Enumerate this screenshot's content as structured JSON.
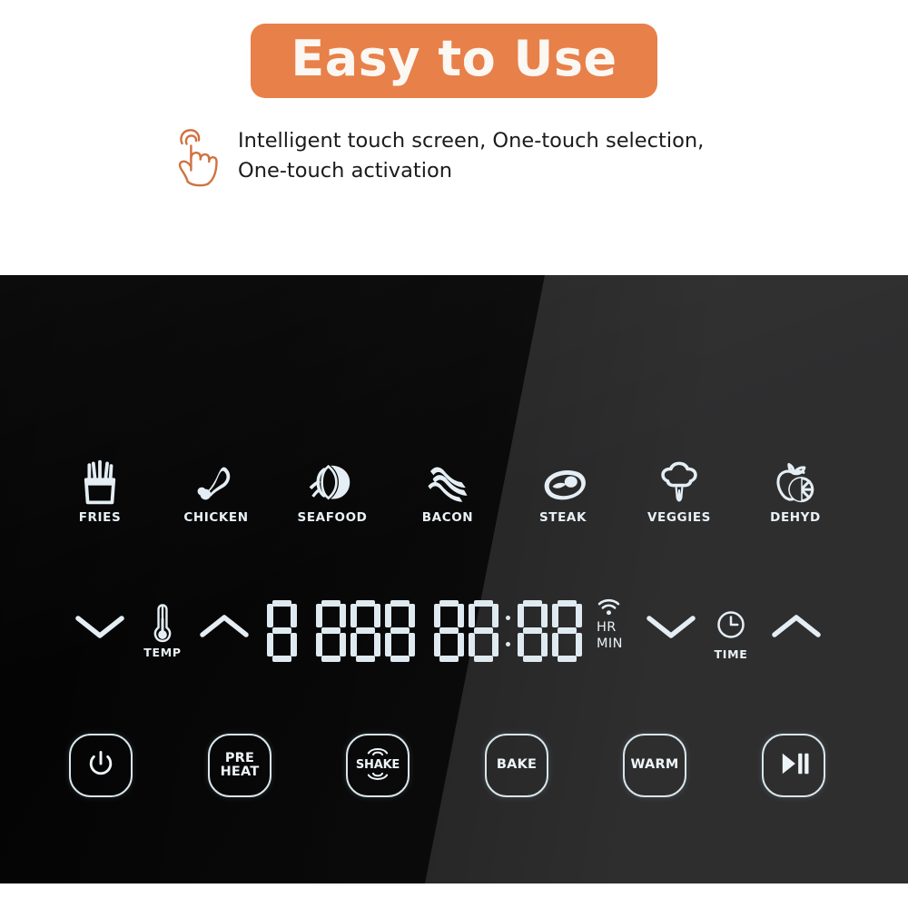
{
  "promo": {
    "badge_label": "Easy to Use",
    "badge_color": "#E8804A",
    "feature_icon": "hand-tap-icon",
    "feature_line1": "Intelligent touch screen, One-touch selection,",
    "feature_line2": "One-touch activation"
  },
  "panel": {
    "background_color": "#2e2e2f",
    "dark_color": "#0a0a0a",
    "led_color": "#dfeaf0",
    "presets": [
      {
        "label": "FRIES",
        "icon": "fries-icon"
      },
      {
        "label": "CHICKEN",
        "icon": "chicken-drumstick-icon"
      },
      {
        "label": "SEAFOOD",
        "icon": "shrimp-icon"
      },
      {
        "label": "BACON",
        "icon": "bacon-icon"
      },
      {
        "label": "STEAK",
        "icon": "steak-icon"
      },
      {
        "label": "VEGGIES",
        "icon": "broccoli-icon"
      },
      {
        "label": "DEHYD",
        "icon": "apple-citrus-icon"
      }
    ],
    "controls": {
      "temp_down": {
        "icon": "chevron-down-icon",
        "label": ""
      },
      "temp": {
        "icon": "thermometer-icon",
        "label": "TEMP"
      },
      "temp_up": {
        "icon": "chevron-up-icon",
        "label": ""
      },
      "time_down": {
        "icon": "chevron-down-icon",
        "label": ""
      },
      "time": {
        "icon": "clock-icon",
        "label": "TIME"
      },
      "time_up": {
        "icon": "chevron-up-icon",
        "label": ""
      }
    },
    "display": {
      "digits": [
        "8",
        "8",
        "8",
        "8",
        "8",
        "8",
        "8",
        "8"
      ],
      "group_gap_after_index": 3,
      "colon_after_index": 5,
      "wifi_icon": "wifi-icon",
      "hr_label": "HR",
      "min_label": "MIN"
    },
    "buttons": [
      {
        "name": "power",
        "label": "",
        "label2": "",
        "icon": "power-icon"
      },
      {
        "name": "preheat",
        "label": "PRE",
        "label2": "HEAT",
        "icon": ""
      },
      {
        "name": "shake",
        "label": "SHAKE",
        "label2": "",
        "icon": "shake-arcs-icon"
      },
      {
        "name": "bake",
        "label": "BAKE",
        "label2": "",
        "icon": ""
      },
      {
        "name": "warm",
        "label": "WARM",
        "label2": "",
        "icon": ""
      },
      {
        "name": "play-pause",
        "label": "",
        "label2": "",
        "icon": "play-pause-icon"
      }
    ]
  }
}
